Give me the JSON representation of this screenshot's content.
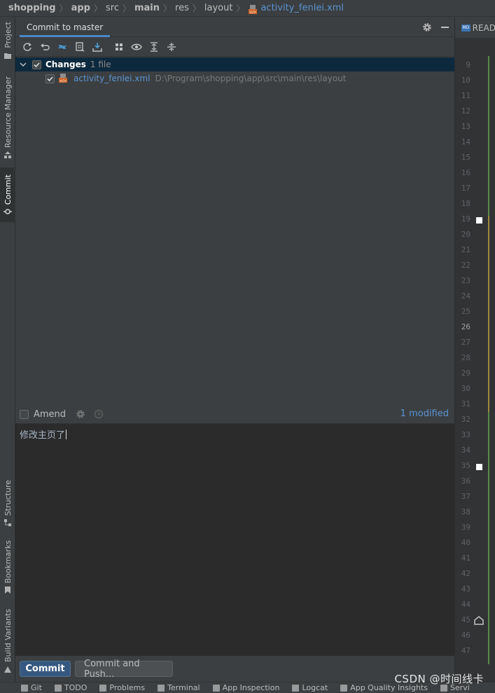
{
  "breadcrumb": {
    "items": [
      "shopping",
      "app",
      "src",
      "main",
      "res",
      "layout"
    ],
    "file": "activity_fenlei.xml"
  },
  "left_strip": {
    "project": "Project",
    "resource_manager": "Resource Manager",
    "commit": "Commit",
    "structure": "Structure",
    "bookmarks": "Bookmarks",
    "build_variants": "Build Variants"
  },
  "panel": {
    "title": "Commit to master",
    "toolbar_icons": [
      "refresh-icon",
      "rollback-icon",
      "diff-icon",
      "shelve-icon",
      "update-icon",
      "group-by-icon",
      "show-icon",
      "expand-all-icon",
      "collapse-all-icon"
    ]
  },
  "changes": {
    "label": "Changes",
    "count": "1 file",
    "checked": true,
    "files": [
      {
        "name": "activity_fenlei.xml",
        "path": "D:\\Program\\shopping\\app\\src\\main\\res\\layout",
        "checked": true
      }
    ]
  },
  "amend": {
    "label": "Amend",
    "checked": false,
    "modified_link": "1 modified"
  },
  "message": {
    "text": "修改主页了"
  },
  "actions": {
    "commit": "Commit",
    "commit_and_push": "Commit and Push..."
  },
  "editor": {
    "tab_label": "READ",
    "line_numbers": [
      "9",
      "10",
      "11",
      "12",
      "13",
      "14",
      "15",
      "16",
      "17",
      "18",
      "19",
      "20",
      "21",
      "22",
      "23",
      "24",
      "25",
      "26",
      "27",
      "28",
      "29",
      "30",
      "31",
      "32",
      "33",
      "34",
      "35",
      "36",
      "37",
      "38",
      "39",
      "40",
      "41",
      "42",
      "43",
      "44",
      "45",
      "46",
      "47"
    ],
    "current_line": "26"
  },
  "bottom_bar": {
    "items": [
      "Git",
      "TODO",
      "Problems",
      "Terminal",
      "App Inspection",
      "Logcat",
      "App Quality Insights",
      "Servi"
    ]
  },
  "watermark": "CSDN @时间线卡",
  "colors": {
    "accent": "#4a88c7",
    "link": "#5894d3",
    "selection": "#0d293e",
    "commit_button": "#365880"
  }
}
